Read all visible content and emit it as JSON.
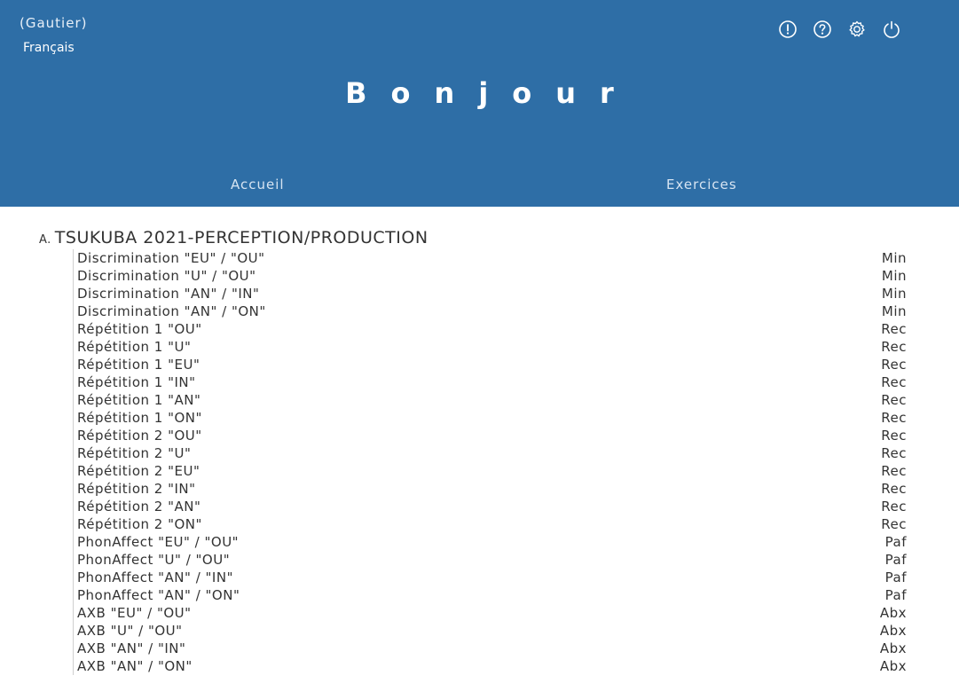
{
  "header": {
    "user_name": "(Gautier)",
    "language": "Français",
    "greeting": "Bonjour",
    "background_color": "#2e6ea6",
    "icons": [
      "info-icon",
      "help-icon",
      "settings-icon",
      "power-icon"
    ]
  },
  "nav": {
    "tabs": [
      {
        "label": "Accueil"
      },
      {
        "label": "Exercices"
      }
    ]
  },
  "section": {
    "letter": "A.",
    "title": "TSUKUBA 2021-PERCEPTION/PRODUCTION",
    "exercises": [
      {
        "name": "Discrimination \"EU\" / \"OU\"",
        "type": "Min"
      },
      {
        "name": "Discrimination \"U\" / \"OU\"",
        "type": "Min"
      },
      {
        "name": "Discrimination \"AN\" / \"IN\"",
        "type": "Min"
      },
      {
        "name": "Discrimination \"AN\" / \"ON\"",
        "type": "Min"
      },
      {
        "name": "Répétition 1 \"OU\"",
        "type": "Rec"
      },
      {
        "name": "Répétition 1 \"U\"",
        "type": "Rec"
      },
      {
        "name": "Répétition 1 \"EU\"",
        "type": "Rec"
      },
      {
        "name": "Répétition 1 \"IN\"",
        "type": "Rec"
      },
      {
        "name": "Répétition 1 \"AN\"",
        "type": "Rec"
      },
      {
        "name": "Répétition 1 \"ON\"",
        "type": "Rec"
      },
      {
        "name": "Répétition 2 \"OU\"",
        "type": "Rec"
      },
      {
        "name": "Répétition 2 \"U\"",
        "type": "Rec"
      },
      {
        "name": "Répétition 2 \"EU\"",
        "type": "Rec"
      },
      {
        "name": "Répétition 2 \"IN\"",
        "type": "Rec"
      },
      {
        "name": "Répétition 2 \"AN\"",
        "type": "Rec"
      },
      {
        "name": "Répétition 2 \"ON\"",
        "type": "Rec"
      },
      {
        "name": "PhonAffect \"EU\" / \"OU\"",
        "type": "Paf"
      },
      {
        "name": "PhonAffect \"U\" / \"OU\"",
        "type": "Paf"
      },
      {
        "name": "PhonAffect \"AN\" / \"IN\"",
        "type": "Paf"
      },
      {
        "name": "PhonAffect \"AN\" / \"ON\"",
        "type": "Paf"
      },
      {
        "name": "AXB \"EU\" / \"OU\"",
        "type": "Abx"
      },
      {
        "name": "AXB \"U\" / \"OU\"",
        "type": "Abx"
      },
      {
        "name": "AXB \"AN\" / \"IN\"",
        "type": "Abx"
      },
      {
        "name": "AXB \"AN\" / \"ON\"",
        "type": "Abx"
      }
    ]
  }
}
